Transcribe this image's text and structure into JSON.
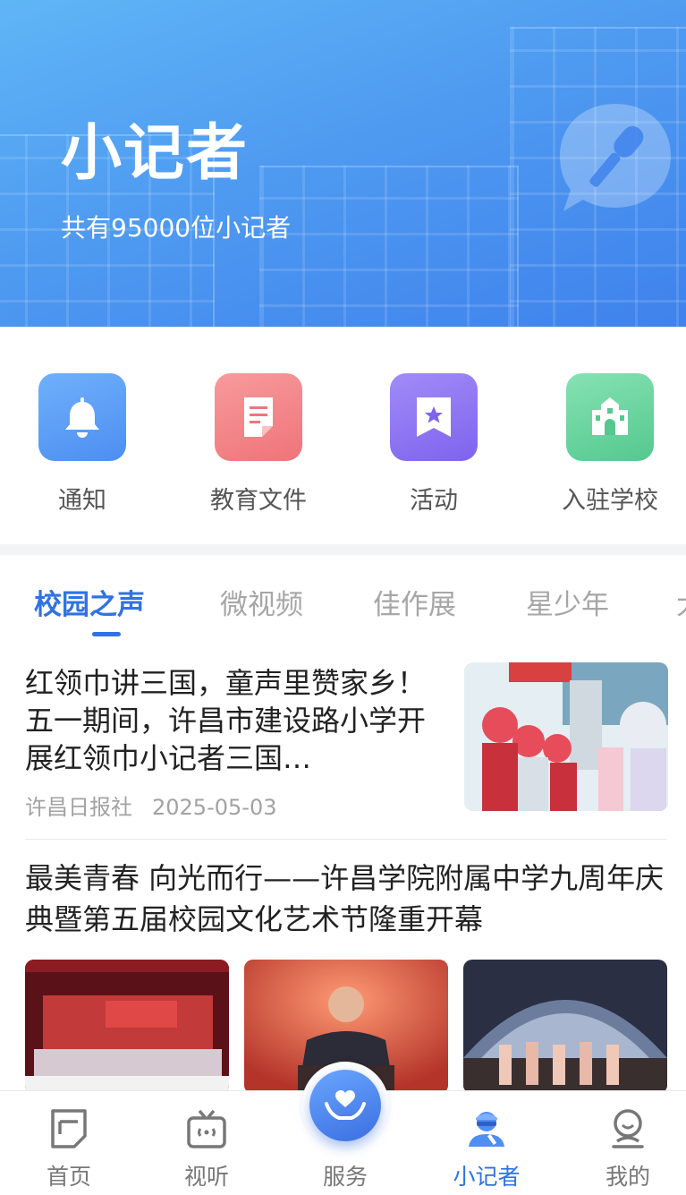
{
  "banner": {
    "title": "小记者",
    "subtitle": "共有95000位小记者",
    "icon": "microphone-bubble-icon"
  },
  "menu": [
    {
      "label": "通知",
      "icon": "bell-icon",
      "color": "#5b9ef6"
    },
    {
      "label": "教育文件",
      "icon": "document-icon",
      "color": "#f37f83"
    },
    {
      "label": "活动",
      "icon": "bookmark-star-icon",
      "color": "#8c72f2"
    },
    {
      "label": "入驻学校",
      "icon": "school-building-icon",
      "color": "#5fd39a"
    }
  ],
  "tabs": [
    "校园之声",
    "微视频",
    "佳作展",
    "星少年",
    "大"
  ],
  "active_tab": 0,
  "articles": [
    {
      "title": "红领巾讲三国，童声里赞家乡！五一期间，许昌市建设路小学开展红领巾小记者三国…",
      "source": "许昌日报社",
      "date": "2025-05-03"
    },
    {
      "title": "最美青春 向光而行——许昌学院附属中学九周年庆典暨第五届校园文化艺术节隆重开幕"
    }
  ],
  "bottom_nav": [
    {
      "label": "首页",
      "icon": "home-doc-icon"
    },
    {
      "label": "视听",
      "icon": "tv-icon"
    },
    {
      "label": "服务",
      "icon": "heart-hands-icon"
    },
    {
      "label": "小记者",
      "icon": "reporter-icon",
      "active": true
    },
    {
      "label": "我的",
      "icon": "profile-icon"
    }
  ],
  "colors": {
    "accent": "#2f72e5",
    "banner_start": "#5fb6f6",
    "banner_end": "#3f82ec"
  }
}
